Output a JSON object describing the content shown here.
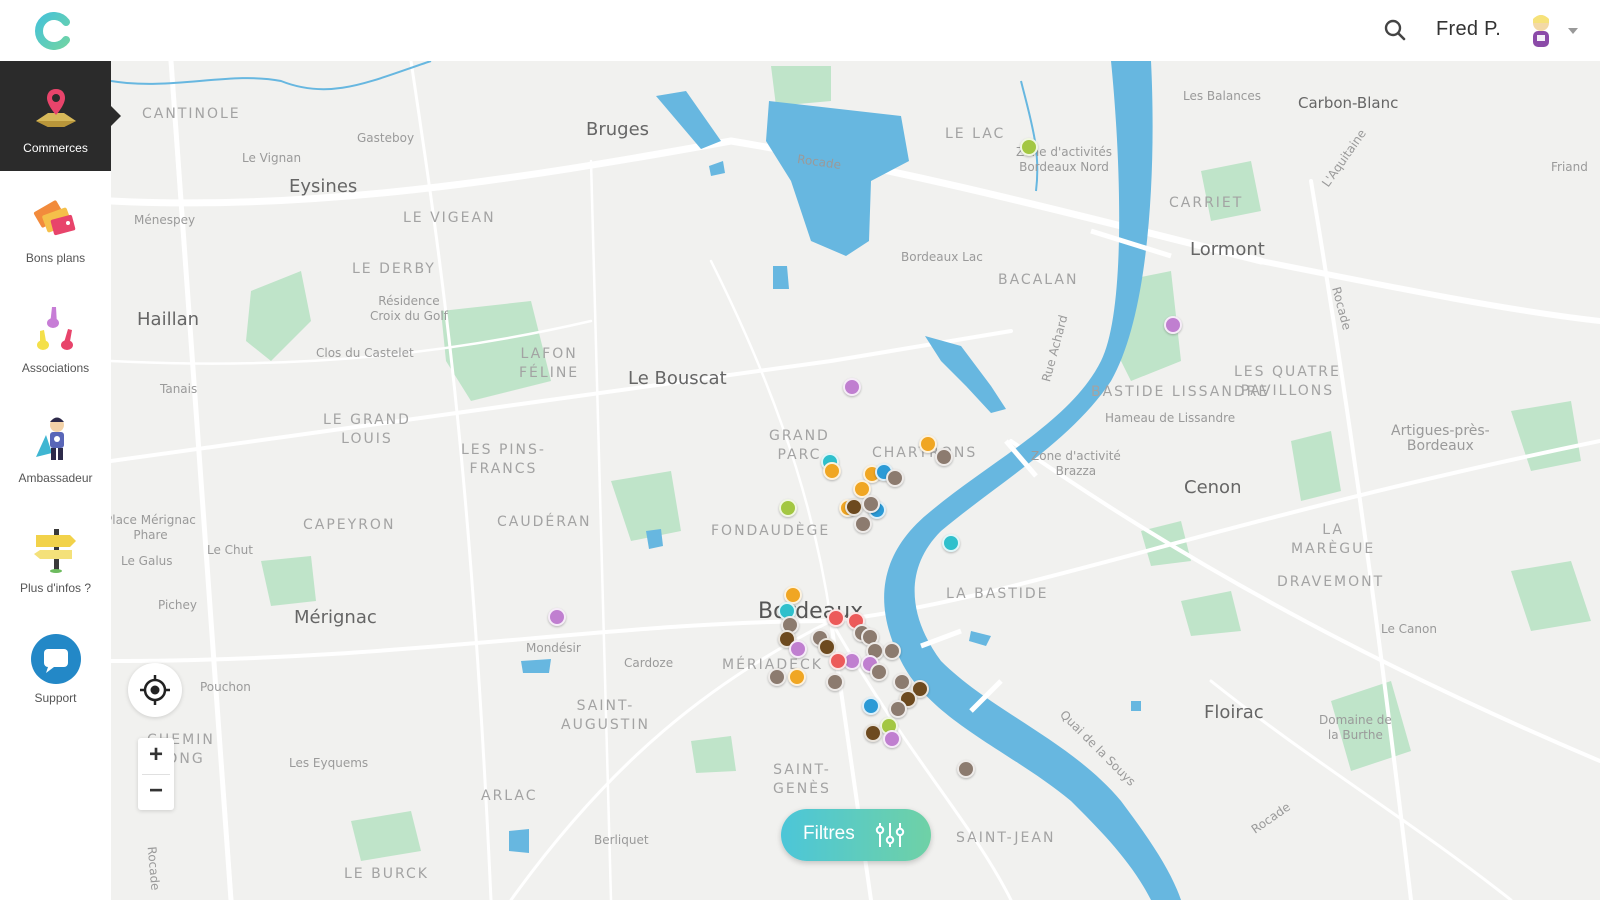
{
  "header": {
    "user_name": "Fred P."
  },
  "sidebar": {
    "items": [
      {
        "label": "Commerces",
        "icon": "map-pin-icon",
        "active": true
      },
      {
        "label": "Bons plans",
        "icon": "coupon-tags-icon",
        "active": false
      },
      {
        "label": "Associations",
        "icon": "raised-hands-icon",
        "active": false
      },
      {
        "label": "Ambassadeur",
        "icon": "superhero-icon",
        "active": false
      },
      {
        "label": "Plus d'infos ?",
        "icon": "signpost-icon",
        "active": false
      },
      {
        "label": "Support",
        "icon": "chat-bubble-icon",
        "active": false
      }
    ]
  },
  "map": {
    "places_big": {
      "bruges": "Bruges",
      "eysines": "Eysines",
      "haillan": "Haillan",
      "le_bouscat": "Le Bouscat",
      "merignac": "Mérignac",
      "bordeaux": "Bordeaux",
      "lormont": "Lormont",
      "cenon": "Cenon",
      "floirac": "Floirac",
      "carbon_blanc": "Carbon-Blanc"
    },
    "districts": {
      "cantinole": "CANTINOLE",
      "le_vigean": "LE VIGEAN",
      "le_derby": "LE DERBY",
      "lafon_feline": "LAFON\nFÉLINE",
      "le_grand_louis": "LE GRAND\nLOUIS",
      "les_pins_francs": "LES PINS-\nFRANCS",
      "capeyron": "CAPEYRON",
      "cauderan": "CAUDÉRAN",
      "grand_parc": "GRAND\nPARC",
      "chartrons": "CHARTRONS",
      "fondaudege": "FONDAUDÈGE",
      "meriadeck": "MÉRIADECK",
      "saint_augustin": "SAINT-\nAUGUSTIN",
      "saint_genes": "SAINT-\nGENÈS",
      "arlac": "ARLAC",
      "le_burck": "LE BURCK",
      "le_lac": "LE LAC",
      "bacalan": "BACALAN",
      "carriet": "CARRIET",
      "la_bastide": "LA BASTIDE",
      "bastide_lissandre": "BASTIDE LISSANDRE",
      "les_quatre_pavillons": "LES QUATRE\nPAVILLONS",
      "la_maregue": "LA\nMARÈGUE",
      "dravemont": "DRAVEMONT",
      "saint_jean": "SAINT-JEAN",
      "chemin_long": "CHEMIN\nLONG"
    },
    "small_places": {
      "gasteboy": "Gasteboy",
      "le_vignan": "Le Vignan",
      "menespey": "Ménespey",
      "residence": "Résidence\nCroix du Golf",
      "clos_castelet": "Clos du Castelet",
      "tanais": "Tanais",
      "le_chut": "Le Chut",
      "le_galus": "Le Galus",
      "pichey": "Pichey",
      "mondesir": "Mondésir",
      "cardoze": "Cardoze",
      "pouchon": "Pouchon",
      "les_eyquems": "Les Eyquems",
      "berlinquet": "Berliquet",
      "bordeaux_lac": "Bordeaux Lac",
      "zone_activites_nord": "Zone d'activités\nBordeaux Nord",
      "les_balances": "Les Balances",
      "friand": "Friand",
      "hameau_lissandre": "Hameau de Lissandre",
      "zone_brazza": "Zone d'activité\nBrazza",
      "artigues": "Artigues-près-\nBordeaux",
      "le_canon": "Le Canon",
      "domaine_burthe": "Domaine de\nla Burthe",
      "phare": "Place Mérignac\nPhare"
    },
    "roads": {
      "rocade_n": "Rocade",
      "rocade_e": "Rocade",
      "rocade_se": "Rocade",
      "rue_achard": "Rue Achard",
      "quai_souys": "Quai de la Souys",
      "l_aquitaine": "L'Aquitaine",
      "rocade_w": "Rocade"
    },
    "marker_colors": {
      "brown": "#8c7b6f",
      "orange": "#f0a623",
      "teal": "#2fc0cc",
      "blue": "#2b9ad6",
      "purple": "#c07fd0",
      "red": "#ec5a5a",
      "green": "#a3c742",
      "dark_brown": "#6d4a1f"
    },
    "filters_label": "Filtres"
  }
}
